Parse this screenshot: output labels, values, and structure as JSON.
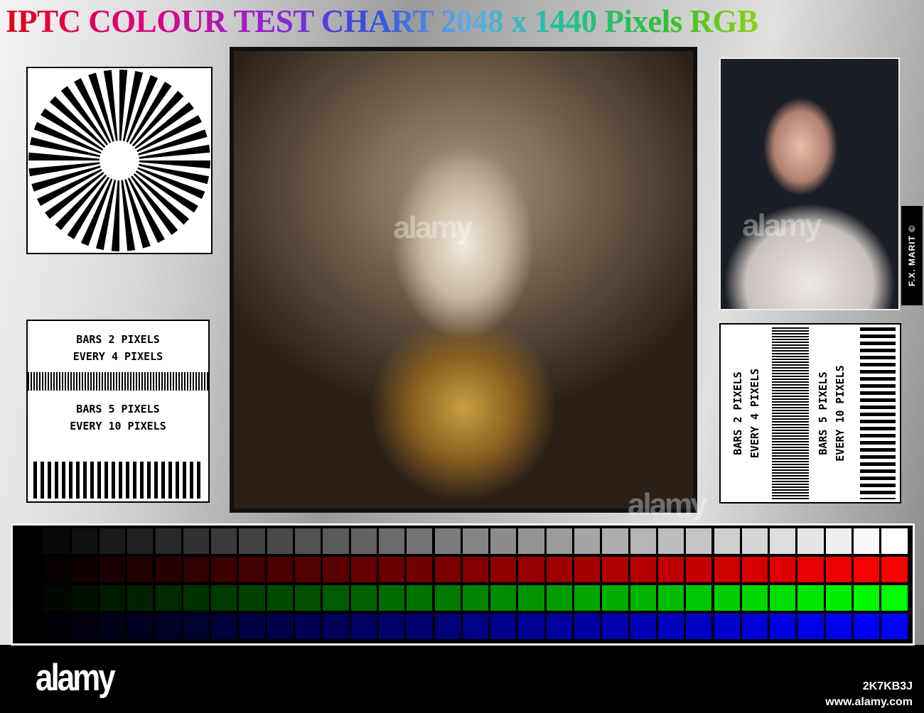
{
  "title": "IPTC COLOUR TEST CHART 2048 x 1440 Pixels RGB",
  "bars_left": {
    "label1_line1": "BARS 2 PIXELS",
    "label1_line2": "EVERY 4 PIXELS",
    "label2_line1": "BARS 5 PIXELS",
    "label2_line2": "EVERY 10 PIXELS"
  },
  "bars_right": {
    "label1_line1": "BARS 2 PIXELS",
    "label1_line2": "EVERY 4 PIXELS",
    "label2_line1": "BARS 5 PIXELS",
    "label2_line2": "EVERY 10 PIXELS"
  },
  "credit": "F.X. MARIT ©",
  "color_grid": {
    "steps": 32,
    "rows": [
      "gray",
      "red",
      "green",
      "blue"
    ]
  },
  "watermark": "alamy",
  "footer": {
    "logo": "alamy",
    "image_id": "2K7KB3J",
    "site": "www.alamy.com"
  }
}
